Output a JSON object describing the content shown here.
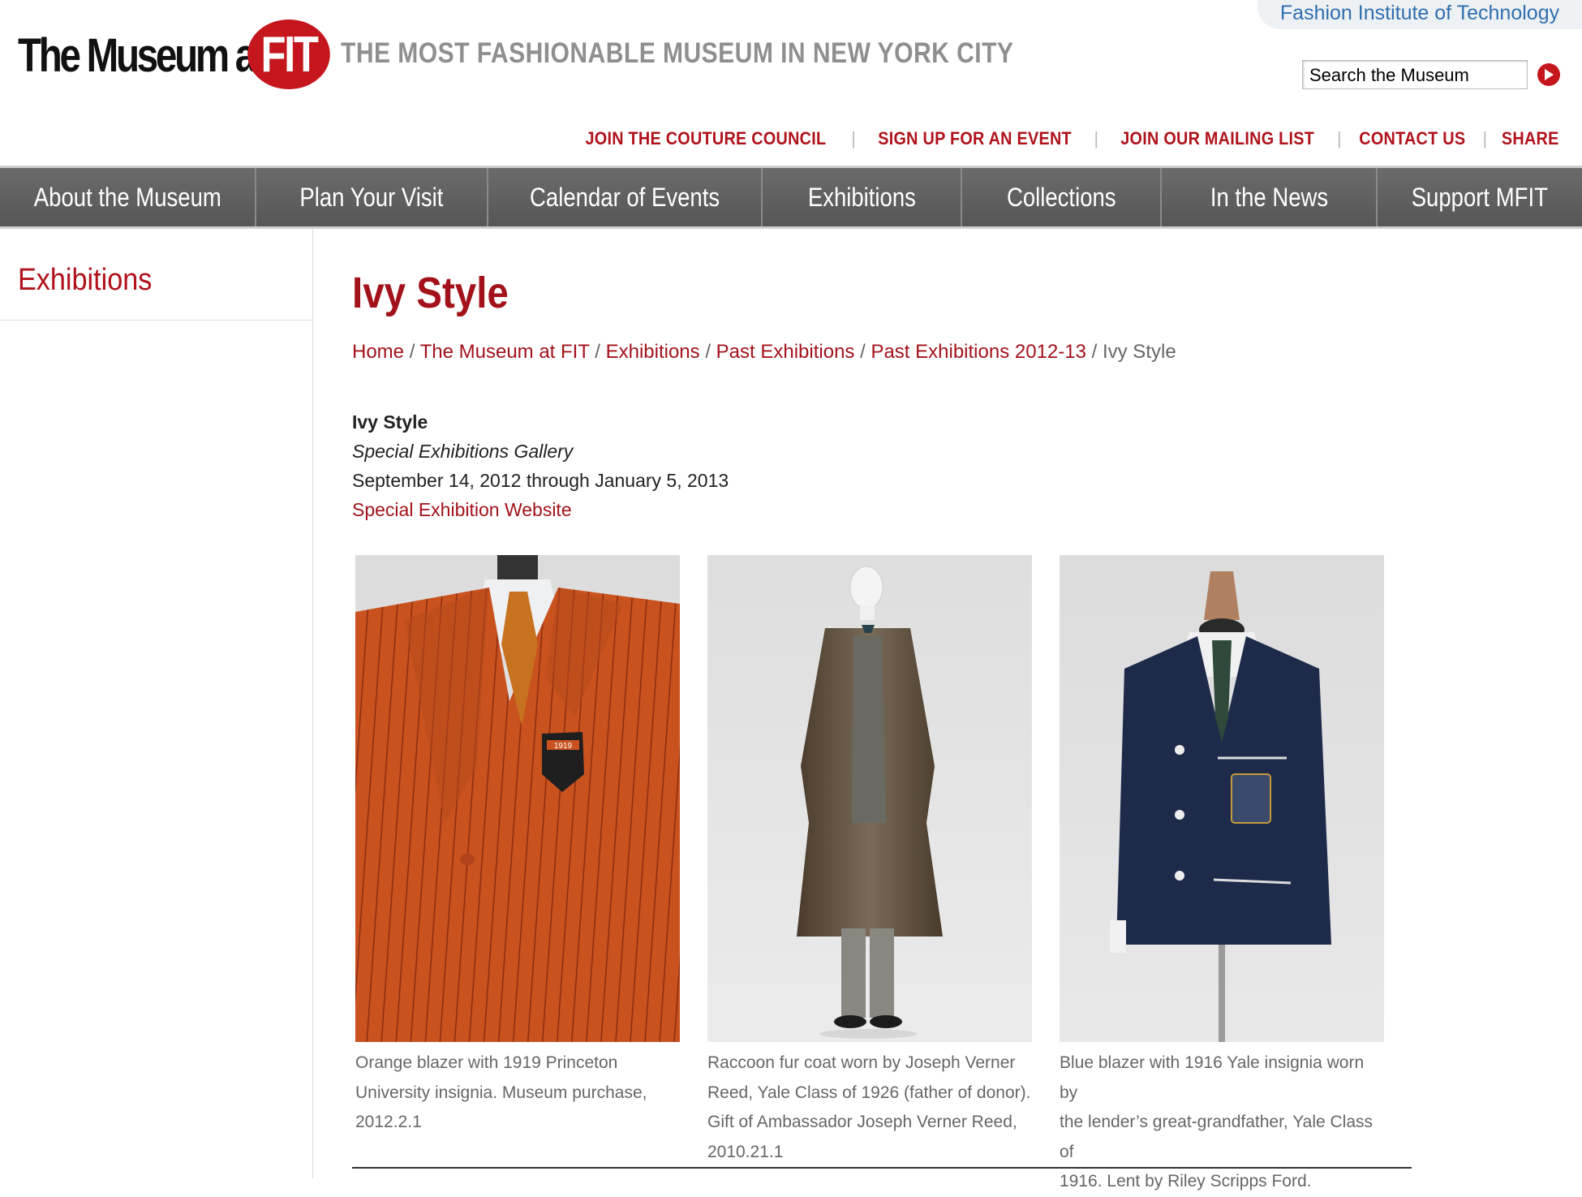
{
  "header": {
    "logo_text": "The Museum at",
    "logo_badge": "FIT",
    "tagline": "THE MOST FASHIONABLE MUSEUM IN NEW YORK CITY",
    "parent_link": "Fashion Institute of Technology",
    "search_placeholder": "Search the Museum",
    "search_button_icon": "arrow-right-icon"
  },
  "utility_links": [
    "JOIN THE COUTURE COUNCIL",
    "SIGN UP FOR AN EVENT",
    "JOIN OUR MAILING LIST",
    "CONTACT US",
    "SHARE"
  ],
  "nav": [
    "About the Museum",
    "Plan Your Visit",
    "Calendar of Events",
    "Exhibitions",
    "Collections",
    "In the News",
    "Support MFIT"
  ],
  "sidebar": {
    "title": "Exhibitions"
  },
  "main": {
    "title": "Ivy Style",
    "breadcrumb": [
      "Home",
      "The Museum at FIT",
      "Exhibitions",
      "Past Exhibitions",
      "Past Exhibitions 2012-13"
    ],
    "breadcrumb_current": "Ivy Style",
    "exhibition": {
      "name": "Ivy Style",
      "gallery": "Special Exhibitions Gallery",
      "dates": "September 14, 2012 through January 5, 2013",
      "website_link": "Special Exhibition Website"
    },
    "images": [
      {
        "caption_lines": [
          "Orange blazer with 1919 Princeton",
          "University insignia. Museum purchase,",
          "2012.2.1"
        ],
        "badge": "1919"
      },
      {
        "caption_lines": [
          "Raccoon fur coat worn by Joseph Verner",
          "Reed, Yale Class of 1926 (father of donor).",
          "Gift of Ambassador Joseph Verner Reed,",
          "2010.21.1"
        ]
      },
      {
        "caption_lines": [
          "Blue blazer with 1916 Yale insignia worn by",
          "the lender’s great-grandfather, Yale Class of",
          "1916. Lent by Riley Scripps Ford."
        ]
      }
    ]
  },
  "colors": {
    "brand_red": "#c4161c",
    "link_red": "#a3121a",
    "nav_gray": "#606060",
    "link_blue": "#2f6fb0"
  }
}
